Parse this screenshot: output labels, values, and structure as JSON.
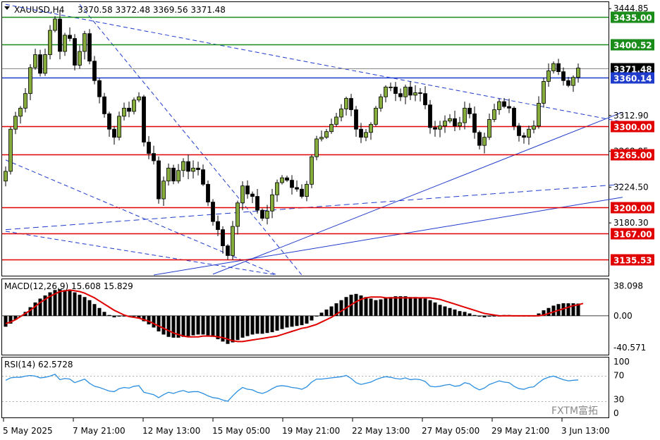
{
  "header": {
    "symbol": "XAUUSD,H4",
    "ohlc": "3370.58 3372.48 3369.56 3371.48"
  },
  "price_axis": {
    "ticks": [
      "3444.85",
      "3312.90",
      "3268.85",
      "3224.50",
      "3180.30"
    ],
    "range": [
      3116.0,
      3452.0
    ]
  },
  "levels": [
    {
      "label": "3435.00",
      "value": 3435.0,
      "color": "#1a8c1a"
    },
    {
      "label": "3400.52",
      "value": 3400.52,
      "color": "#1a8c1a"
    },
    {
      "label": "3371.48",
      "value": 3371.48,
      "color": "#000000",
      "current": true
    },
    {
      "label": "3360.14",
      "value": 3360.14,
      "color": "#1f3bcc"
    },
    {
      "label": "3300.00",
      "value": 3300.0,
      "color": "#e00000"
    },
    {
      "label": "3265.00",
      "value": 3265.0,
      "color": "#e00000"
    },
    {
      "label": "3200.00",
      "value": 3200.0,
      "color": "#e00000"
    },
    {
      "label": "3167.00",
      "value": 3167.0,
      "color": "#e00000"
    },
    {
      "label": "3135.53",
      "value": 3135.53,
      "color": "#e00000"
    }
  ],
  "macd": {
    "label": "MACD(12,26,9) 15.608 15.829",
    "ticks": [
      "38.098",
      "0.00",
      "-40.571"
    ],
    "range": [
      -48,
      45
    ]
  },
  "rsi": {
    "label": "RSI(14) 62.5728",
    "ticks": [
      "100",
      "70",
      "30",
      "0"
    ],
    "range": [
      0,
      100
    ]
  },
  "time_axis": [
    "5 May 2025",
    "7 May 21:00",
    "12 May 13:00",
    "15 May 05:00",
    "19 May 21:00",
    "22 May 13:00",
    "27 May 05:00",
    "29 May 21:00",
    "3 Jun 13:00"
  ],
  "watermark": "FXTM富拓",
  "colors": {
    "bull": "#ffffff",
    "bear": "#000000",
    "candle_up": "#86ad3c",
    "macd_signal": "#e00000",
    "rsi_line": "#2a8ee0",
    "trend_blue": "#1f3bcc"
  },
  "chart_data": {
    "type": "candlestick",
    "title": "XAUUSD,H4",
    "closes": [
      3244,
      3296,
      3312,
      3322,
      3340,
      3372,
      3388,
      3365,
      3388,
      3418,
      3432,
      3392,
      3412,
      3408,
      3375,
      3392,
      3414,
      3380,
      3356,
      3336,
      3315,
      3296,
      3286,
      3312,
      3322,
      3318,
      3332,
      3336,
      3280,
      3266,
      3257,
      3210,
      3232,
      3248,
      3232,
      3245,
      3256,
      3244,
      3248,
      3246,
      3228,
      3206,
      3182,
      3172,
      3152,
      3140,
      3176,
      3205,
      3226,
      3216,
      3213,
      3196,
      3186,
      3195,
      3215,
      3230,
      3236,
      3233,
      3224,
      3222,
      3213,
      3228,
      3262,
      3284,
      3286,
      3293,
      3302,
      3311,
      3321,
      3334,
      3320,
      3296,
      3286,
      3292,
      3302,
      3322,
      3336,
      3348,
      3348,
      3340,
      3336,
      3348,
      3338,
      3341,
      3340,
      3326,
      3298,
      3296,
      3300,
      3306,
      3309,
      3300,
      3304,
      3322,
      3315,
      3292,
      3276,
      3286,
      3308,
      3320,
      3330,
      3324,
      3322,
      3300,
      3288,
      3286,
      3296,
      3300,
      3328,
      3355,
      3368,
      3377,
      3367,
      3356,
      3350,
      3360,
      3371.48
    ],
    "macd_hist": [
      -14,
      -10,
      -5,
      0,
      5,
      11,
      17,
      22,
      26,
      30,
      33,
      34,
      33,
      32,
      30,
      27,
      24,
      20,
      15,
      10,
      5,
      1,
      -2,
      -1,
      0,
      0,
      -1,
      -3,
      -7,
      -11,
      -15,
      -20,
      -24,
      -27,
      -28,
      -28,
      -27,
      -26,
      -25,
      -24,
      -24,
      -25,
      -27,
      -30,
      -33,
      -36,
      -34,
      -31,
      -28,
      -26,
      -24,
      -23,
      -23,
      -22,
      -21,
      -19,
      -17,
      -15,
      -14,
      -13,
      -12,
      -10,
      -6,
      0,
      4,
      8,
      12,
      16,
      20,
      24,
      27,
      28,
      26,
      24,
      22,
      20,
      21,
      23,
      24,
      25,
      25,
      25,
      24,
      24,
      23,
      22,
      20,
      17,
      14,
      12,
      10,
      8,
      6,
      5,
      3,
      1,
      -1,
      -2,
      -1,
      0,
      0,
      1,
      1,
      0,
      0,
      -1,
      -1,
      0,
      3,
      7,
      10,
      13,
      15,
      16,
      16,
      16,
      15.608
    ],
    "macd_signal": [
      -10,
      -8,
      -5,
      -1,
      3,
      7,
      12,
      17,
      21,
      25,
      28,
      31,
      32,
      33,
      32,
      31,
      29,
      26,
      23,
      19,
      15,
      11,
      7,
      4,
      1,
      -1,
      -2,
      -3,
      -5,
      -7,
      -10,
      -13,
      -16,
      -19,
      -22,
      -24,
      -26,
      -27,
      -27,
      -27,
      -26,
      -26,
      -26,
      -27,
      -28,
      -30,
      -32,
      -33,
      -33,
      -32,
      -31,
      -30,
      -29,
      -28,
      -27,
      -26,
      -24,
      -22,
      -20,
      -18,
      -16,
      -15,
      -13,
      -11,
      -8,
      -5,
      -2,
      2,
      6,
      10,
      14,
      18,
      21,
      23,
      24,
      24,
      24,
      23,
      23,
      23,
      23,
      23,
      23,
      23,
      23,
      23,
      23,
      22,
      21,
      19,
      17,
      15,
      13,
      11,
      9,
      7,
      5,
      3,
      2,
      1,
      0,
      0,
      0,
      0,
      0,
      0,
      0,
      0,
      0,
      1,
      3,
      5,
      7,
      9,
      11,
      13,
      14,
      15.829
    ],
    "rsi": [
      62,
      66,
      67,
      67,
      69,
      70,
      69,
      66,
      67,
      69,
      72,
      63,
      65,
      64,
      58,
      61,
      64,
      57,
      52,
      50,
      47,
      44,
      43,
      48,
      50,
      49,
      52,
      53,
      42,
      40,
      38,
      33,
      38,
      42,
      40,
      43,
      45,
      42,
      43,
      43,
      40,
      36,
      33,
      32,
      29,
      27,
      36,
      44,
      50,
      47,
      46,
      42,
      40,
      43,
      48,
      52,
      53,
      52,
      50,
      49,
      47,
      51,
      59,
      64,
      64,
      65,
      66,
      67,
      68,
      70,
      65,
      58,
      55,
      57,
      59,
      63,
      66,
      68,
      67,
      65,
      64,
      66,
      63,
      64,
      63,
      60,
      52,
      51,
      52,
      54,
      55,
      52,
      53,
      58,
      56,
      50,
      46,
      49,
      55,
      58,
      61,
      59,
      58,
      52,
      48,
      47,
      50,
      51,
      58,
      64,
      67,
      69,
      66,
      63,
      61,
      62,
      62.5728
    ]
  }
}
